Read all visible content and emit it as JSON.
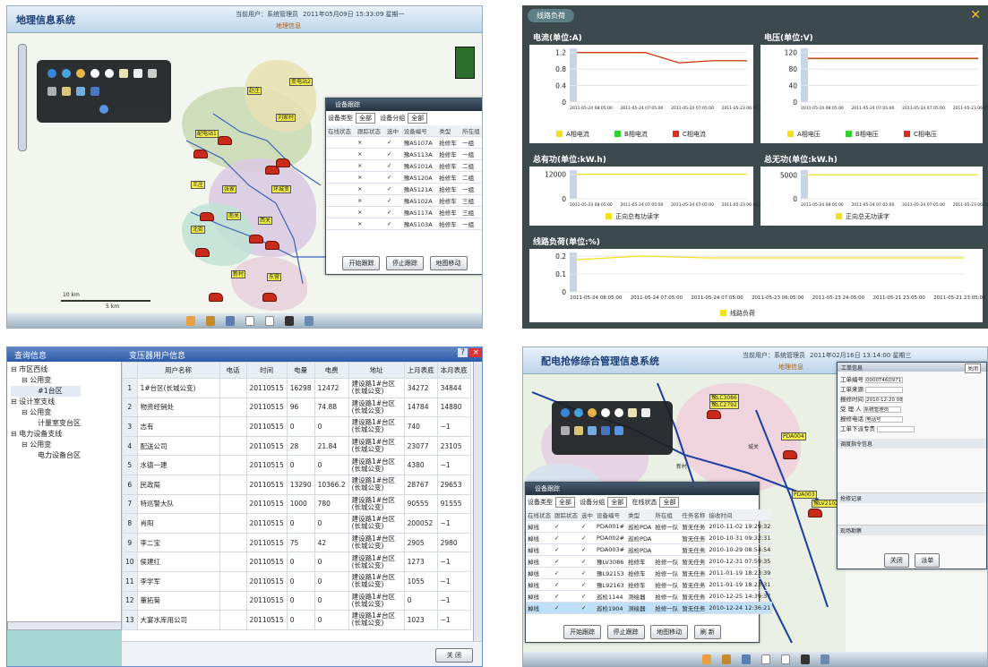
{
  "tl": {
    "title": "地理信息系统",
    "user": "当前用户：系统管理员",
    "datetime": "2011年05月09日 15:33:09 星期一",
    "sub": "地理信息",
    "map_labels": [
      "配电站1",
      "变电站2",
      "赵庄",
      "刘家村",
      "王庄",
      "张家",
      "环城变",
      "北街",
      "南关",
      "西关",
      "新村",
      "东营"
    ],
    "scale": [
      "10 km",
      "5 km"
    ],
    "dialog": {
      "title": "设备跟踪",
      "filters": [
        {
          "label": "设备类型",
          "value": "全部"
        },
        {
          "label": "设备分组",
          "value": "全部"
        },
        {
          "label": "在线状态",
          "value": "全部"
        }
      ],
      "columns": [
        "在线状态",
        "跟踪状态",
        "选中",
        "设备编号",
        "类型",
        "所在组",
        "任"
      ],
      "rows": [
        [
          "",
          "×",
          "✓",
          "豫A5107A",
          "抢修车",
          "一组",
          "警"
        ],
        [
          "",
          "×",
          "✓",
          "豫A5113A",
          "抢修车",
          "一组",
          "警"
        ],
        [
          "",
          "×",
          "✓",
          "豫A5101A",
          "抢修车",
          "二组",
          "警"
        ],
        [
          "",
          "×",
          "✓",
          "豫A5120A",
          "抢修车",
          "二组",
          "警"
        ],
        [
          "",
          "×",
          "✓",
          "豫A5121A",
          "抢修车",
          "一组",
          "警"
        ],
        [
          "",
          "×",
          "✓",
          "豫A5102A",
          "抢修车",
          "三组",
          "任"
        ],
        [
          "",
          "×",
          "✓",
          "豫A5117A",
          "抢修车",
          "三组",
          "计"
        ],
        [
          "",
          "×",
          "✓",
          "豫A5103A",
          "抢修车",
          "一组",
          "警"
        ]
      ],
      "buttons": [
        "开始跟踪",
        "停止跟踪",
        "地图移动"
      ]
    }
  },
  "tr": {
    "tab": "线路负荷",
    "panels": [
      {
        "title": "电流(单位:A)",
        "legend": [
          "A相电流",
          "B相电流",
          "C相电流"
        ]
      },
      {
        "title": "电压(单位:V)",
        "legend": [
          "A相电压",
          "B相电压",
          "C相电压"
        ]
      },
      {
        "title": "总有功(单位:kW.h)",
        "legend": [
          "正向总有功读字"
        ]
      },
      {
        "title": "总无功(单位:kW.h)",
        "legend": [
          "正向总无功读字"
        ]
      },
      {
        "title": "线路负荷(单位:%)",
        "legend": [
          "线路负荷"
        ]
      }
    ],
    "xticks": [
      "2011-05-24 08:05:00",
      "2011-05-24 07:05:00",
      "2011-05-24 07:05:00",
      "2011-05-23 06:05:00",
      "2011-05-23 24:05:00",
      "2011-05-21 23:05:00",
      "2011-05-21 23:05:00"
    ],
    "colors": {
      "a": "#f2e01a",
      "b": "#2ad22a",
      "c": "#e02a1a"
    }
  },
  "chart_data": [
    {
      "type": "line",
      "title": "电流(单位:A)",
      "ylim": [
        0,
        1.3
      ],
      "yticks": [
        0,
        0.4,
        0.8,
        1.2
      ],
      "series": [
        {
          "name": "A相电流",
          "values": [
            1.2,
            1.2,
            1.2,
            0.95,
            1.0,
            1.0
          ]
        },
        {
          "name": "B相电流",
          "values": [
            1.2,
            1.2,
            1.2,
            0.95,
            1.0,
            1.0
          ]
        },
        {
          "name": "C相电流",
          "values": [
            1.2,
            1.2,
            1.2,
            0.95,
            1.0,
            1.0
          ]
        }
      ]
    },
    {
      "type": "line",
      "title": "电压(单位:V)",
      "ylim": [
        0,
        130
      ],
      "yticks": [
        0,
        40,
        80,
        120
      ],
      "series": [
        {
          "name": "A相电压",
          "values": [
            105,
            105,
            105,
            105,
            105,
            105
          ]
        },
        {
          "name": "B相电压",
          "values": [
            105,
            105,
            105,
            105,
            105,
            105
          ]
        },
        {
          "name": "C相电压",
          "values": [
            106,
            106,
            106,
            106,
            106,
            106
          ]
        }
      ]
    },
    {
      "type": "line",
      "title": "总有功(单位:kW.h)",
      "ylim": [
        0,
        14000
      ],
      "yticks": [
        0,
        12000
      ],
      "series": [
        {
          "name": "正向总有功读字",
          "values": [
            12000,
            12000,
            12000,
            12000,
            12000,
            12000
          ]
        }
      ]
    },
    {
      "type": "line",
      "title": "总无功(单位:kW.h)",
      "ylim": [
        0,
        6000
      ],
      "yticks": [
        0,
        5000
      ],
      "series": [
        {
          "name": "正向总无功读字",
          "values": [
            5000,
            5000,
            5000,
            5000,
            5000,
            5000
          ]
        }
      ]
    },
    {
      "type": "line",
      "title": "线路负荷(单位:%)",
      "ylim": [
        0,
        0.22
      ],
      "yticks": [
        0,
        0.1,
        0.2
      ],
      "series": [
        {
          "name": "线路负荷",
          "values": [
            0.18,
            0.2,
            0.19,
            0.19,
            0.19,
            0.19,
            0.19
          ]
        }
      ]
    }
  ],
  "bl": {
    "left_title": "查询信息",
    "tree": [
      "市区西线",
      "公用变",
      "#1台区",
      "设计室支线",
      "公用变",
      "计量室变台区",
      "电力设备支线",
      "公用变",
      "电力设备台区"
    ],
    "right_title": "变压器用户信息",
    "help": "?",
    "close": "×",
    "columns": [
      "用户名称",
      "电话",
      "时间",
      "电量",
      "电费",
      "地址",
      "上月表底",
      "本月表底"
    ],
    "rows": [
      [
        "1",
        "1#台区(长城公变)",
        "",
        "20110515",
        "16298",
        "12472",
        "建设路1#台区(长城公变)",
        "34272",
        "34844"
      ],
      [
        "2",
        "物资经销处",
        "",
        "20110515",
        "96",
        "74.88",
        "建设路1#台区(长城公变)",
        "14784",
        "14880"
      ],
      [
        "3",
        "志有",
        "",
        "20110515",
        "0",
        "0",
        "建设路1#台区(长城公变)",
        "740",
        "~1"
      ],
      [
        "4",
        "配送公司",
        "",
        "20110515",
        "28",
        "21.84",
        "建设路1#台区(长城公变)",
        "23077",
        "23105"
      ],
      [
        "5",
        "水德一建",
        "",
        "20110515",
        "0",
        "0",
        "建设路1#台区(长城公变)",
        "4380",
        "~1"
      ],
      [
        "6",
        "民政局",
        "",
        "20110515",
        "13290",
        "10366.2",
        "建设路1#台区(长城公变)",
        "28767",
        "29653"
      ],
      [
        "7",
        "特巡警大队",
        "",
        "20110515",
        "1000",
        "780",
        "建设路1#台区(长城公变)",
        "90555",
        "91555"
      ],
      [
        "8",
        "肖阳",
        "",
        "20110515",
        "0",
        "0",
        "建设路1#台区(长城公变)",
        "200052",
        "~1"
      ],
      [
        "9",
        "李二宝",
        "",
        "20110515",
        "75",
        "42",
        "建设路1#台区(长城公变)",
        "2905",
        "2980"
      ],
      [
        "10",
        "侯建红",
        "",
        "20110515",
        "0",
        "0",
        "建设路1#台区(长城公变)",
        "1273",
        "~1"
      ],
      [
        "11",
        "李学军",
        "",
        "20110515",
        "0",
        "0",
        "建设路1#台区(长城公变)",
        "1055",
        "~1"
      ],
      [
        "12",
        "董拓菊",
        "",
        "20110515",
        "0",
        "0",
        "建设路1#台区(长城公变)",
        "0",
        "~1"
      ],
      [
        "13",
        "大宴水库用公司",
        "",
        "20110515",
        "0",
        "0",
        "建设路1#台区(长城公变)",
        "1023",
        "~1"
      ]
    ],
    "close_btn": "关 闭"
  },
  "br": {
    "title": "配电抢修综合管理信息系统",
    "user": "当前用户：系统管理员",
    "datetime": "2011年02月16日 13:14:00 星期三",
    "sub": "地理信息",
    "map_labels": [
      "豫LC3086",
      "豫LC2792",
      "PDA004",
      "城关",
      "新村",
      "PDA003",
      "豫LV2102"
    ],
    "dialog": {
      "title": "设备跟踪",
      "filters": [
        {
          "label": "设备类型",
          "value": "全部"
        },
        {
          "label": "设备分组",
          "value": "全部"
        },
        {
          "label": "在线状态",
          "value": "全部"
        },
        {
          "label": "设备编号",
          "value": ""
        }
      ],
      "columns": [
        "在线状态",
        "跟踪状态",
        "选中",
        "设备编号",
        "类型",
        "所在组",
        "任务名称",
        "接收时间"
      ],
      "rows": [
        [
          "掉线",
          "✓",
          "✓",
          "PDA001#",
          "巡检PDA",
          "抢修一队",
          "暂无任务",
          "2010-11-02 19:29:32"
        ],
        [
          "掉线",
          "✓",
          "✓",
          "PDA002#",
          "巡检PDA",
          "",
          "暂无任务",
          "2010-10-31 09:32:31"
        ],
        [
          "掉线",
          "✓",
          "✓",
          "PDA003#",
          "巡检PDA",
          "",
          "暂无任务",
          "2010-10-29 08:54:54"
        ],
        [
          "掉线",
          "✓",
          "✓",
          "豫LV3086",
          "抢修车",
          "抢修一队",
          "暂无任务",
          "2010-12-31 07:59:35"
        ],
        [
          "掉线",
          "✓",
          "✓",
          "豫L92153",
          "抢修车",
          "抢修一队",
          "暂无任务",
          "2011-01-19 18:23:39"
        ],
        [
          "掉线",
          "✓",
          "✓",
          "豫L92163",
          "抢修车",
          "抢修一队",
          "暂无任务",
          "2011-01-19 18:23:31"
        ],
        [
          "掉线",
          "✓",
          "✓",
          "巡检1144",
          "测绘器",
          "抢修一队",
          "暂无任务",
          "2010-12-25 14:39:37"
        ],
        [
          "掉线",
          "✓",
          "✓",
          "巡检1904",
          "测绘器",
          "抢修一队",
          "暂无任务",
          "2010-12-24 12:36:21"
        ]
      ],
      "buttons": [
        "开始跟踪",
        "停止跟踪",
        "地图移动",
        "刷 新"
      ]
    },
    "form": {
      "title": "工单信息",
      "close": "关闭",
      "fields": [
        [
          "工单编号",
          "0000T46D9711EF1"
        ],
        [
          "工单来源",
          ""
        ],
        [
          "报修时间",
          "2010-12-20 08:18:36"
        ],
        [
          "受 理 人",
          "系统管理员"
        ],
        [
          "报修电话",
          "电话号"
        ],
        [
          "工单下派专责",
          ""
        ]
      ],
      "section2": "调度指令信息",
      "section3": "抢修记录",
      "section4": "现场勘察",
      "buttons": [
        "关闭",
        "派单"
      ]
    }
  }
}
